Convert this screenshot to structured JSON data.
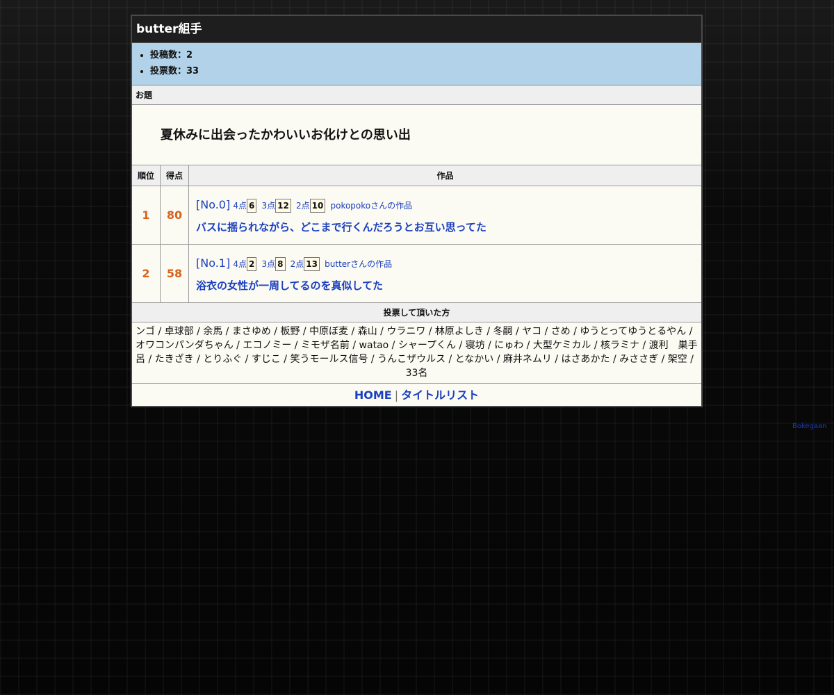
{
  "panel": {
    "title": "butter組手"
  },
  "stats": [
    {
      "label": "投稿数：2"
    },
    {
      "label": "投票数：33"
    }
  ],
  "odai": {
    "label": "お題",
    "text": "夏休みに出会ったかわいいお化けとの思い出"
  },
  "table": {
    "headers": {
      "rank": "順位",
      "score": "得点",
      "work": "作品"
    },
    "rows": [
      {
        "rank": "1",
        "score": "80",
        "no": "[No.0]",
        "p4_label": "4点",
        "p4": "6",
        "p3_label": "3点",
        "p3": "12",
        "p2_label": "2点",
        "p2": "10",
        "author": "pokopokoさんの作品",
        "title": "バスに揺られながら、どこまで行くんだろうとお互い思ってた"
      },
      {
        "rank": "2",
        "score": "58",
        "no": "[No.1]",
        "p4_label": "4点",
        "p4": "2",
        "p3_label": "3点",
        "p3": "8",
        "p2_label": "2点",
        "p2": "13",
        "author": "butterさんの作品",
        "title": "浴衣の女性が一周してるのを真似してた"
      }
    ]
  },
  "voters": {
    "heading": "投票して頂いた方",
    "list": "ンゴ / 卓球部 / 余馬 / まさゆめ / 板野 / 中原ぼ麦 / 森山 / ウラニワ / 林原よしき / 冬嗣 / ヤコ / さめ / ゆうとってゆうとるやん / オワコンパンダちゃん / エコノミー / ミモザ名前 / watao / シャープくん / 寝坊 / にゅわ / 大型ケミカル / 核ラミナ / 渡利　巣手呂 / たきざき / とりふぐ / すじこ / 笑うモールス信号 / うんこザウルス / となかい / 麻井ネムリ / はさあかた / みささぎ / 架空 /",
    "count": "33名"
  },
  "nav": {
    "home": "HOME",
    "sep": "|",
    "titles": "タイトルリスト"
  },
  "credit": "Bokegaan",
  "colors": {
    "accent": "#1a3fbf",
    "rank": "#d9621a",
    "stats_bg": "#b1d2e8",
    "header_bg": "#1e1e1e"
  }
}
